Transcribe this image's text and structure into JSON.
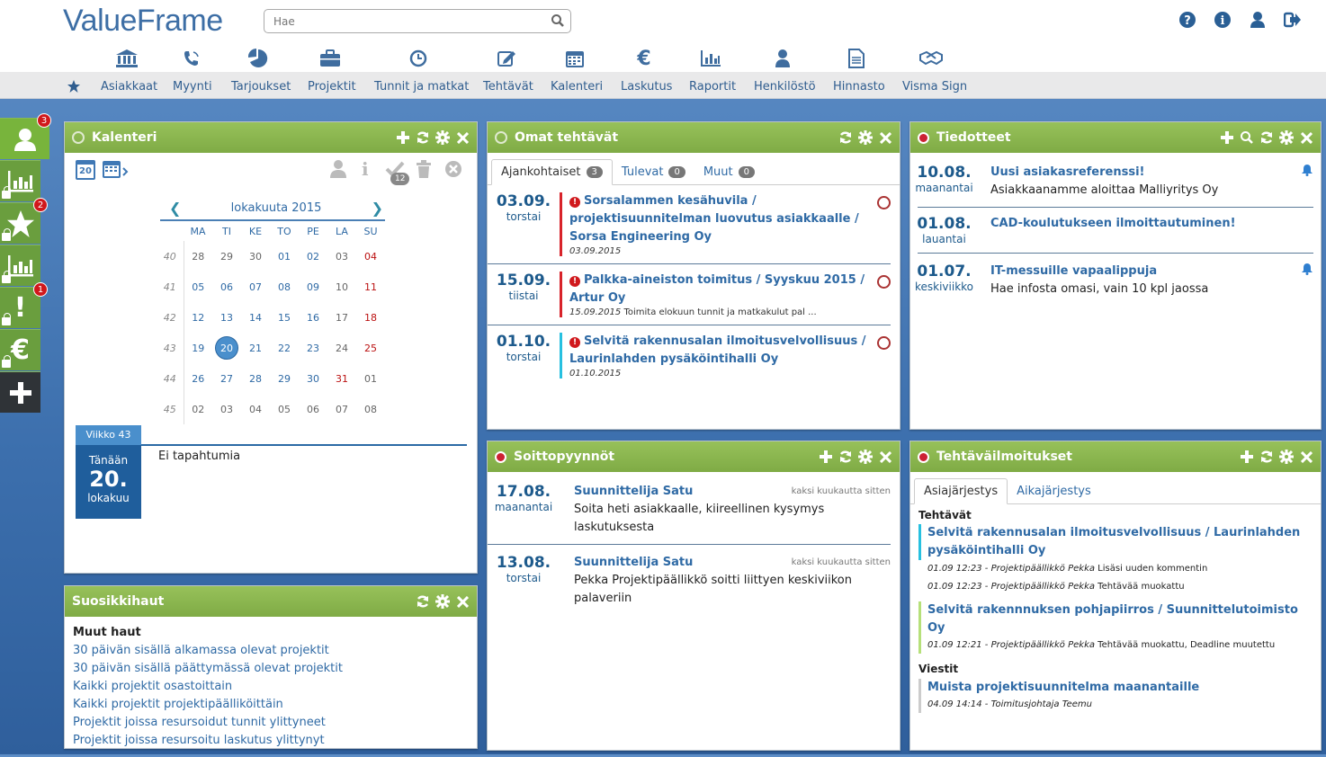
{
  "app": {
    "logo": "ValueFrame",
    "search_placeholder": "Hae"
  },
  "nav": [
    {
      "label": "Asiakkaat",
      "icon": "bank-icon"
    },
    {
      "label": "Myynti",
      "icon": "phone-icon"
    },
    {
      "label": "Tarjoukset",
      "icon": "pie-icon"
    },
    {
      "label": "Projektit",
      "icon": "briefcase-icon"
    },
    {
      "label": "Tunnit ja matkat",
      "icon": "clock-icon"
    },
    {
      "label": "Tehtävät",
      "icon": "edit-icon"
    },
    {
      "label": "Kalenteri",
      "icon": "calendar-icon"
    },
    {
      "label": "Laskutus",
      "icon": "euro-icon"
    },
    {
      "label": "Raportit",
      "icon": "bar-chart-icon"
    },
    {
      "label": "Henkilöstö",
      "icon": "user-icon"
    },
    {
      "label": "Hinnasto",
      "icon": "document-icon"
    },
    {
      "label": "Visma Sign",
      "icon": "handshake-icon"
    }
  ],
  "sidebar": {
    "badges": {
      "users": "3",
      "favorites": "2",
      "alerts": "1"
    }
  },
  "kalenteri": {
    "title": "Kalenteri",
    "toolbar_day": "20",
    "badge": "12",
    "month": "lokakuuta 2015",
    "weekdays": [
      "MA",
      "TI",
      "KE",
      "TO",
      "PE",
      "LA",
      "SU"
    ],
    "weeks": [
      {
        "wk": "40",
        "days": [
          "28",
          "29",
          "30",
          "01",
          "02",
          "03",
          "04"
        ]
      },
      {
        "wk": "41",
        "days": [
          "05",
          "06",
          "07",
          "08",
          "09",
          "10",
          "11"
        ]
      },
      {
        "wk": "42",
        "days": [
          "12",
          "13",
          "14",
          "15",
          "16",
          "17",
          "18"
        ]
      },
      {
        "wk": "43",
        "days": [
          "19",
          "20",
          "21",
          "22",
          "23",
          "24",
          "25"
        ]
      },
      {
        "wk": "44",
        "days": [
          "26",
          "27",
          "28",
          "29",
          "30",
          "31",
          "01"
        ]
      },
      {
        "wk": "45",
        "days": [
          "02",
          "03",
          "04",
          "05",
          "06",
          "07",
          "08"
        ]
      }
    ],
    "week_label": "Viikko 43",
    "today_label": "Tänään",
    "today_day": "20.",
    "today_month": "lokakuu",
    "no_events": "Ei tapahtumia"
  },
  "tasks": {
    "title": "Omat tehtävät",
    "tabs": [
      {
        "label": "Ajankohtaiset",
        "count": "3"
      },
      {
        "label": "Tulevat",
        "count": "0"
      },
      {
        "label": "Muut",
        "count": "0"
      }
    ],
    "items": [
      {
        "date": "03.09.",
        "weekday": "torstai",
        "title": "Sorsalammen kesähuvila / projektisuunnitelman luovutus asiakkaalle / Sorsa Engineering Oy",
        "meta": "03.09.2015",
        "note": ""
      },
      {
        "date": "15.09.",
        "weekday": "tiistai",
        "title": "Palkka-aineiston toimitus / Syyskuu 2015 / Artur Oy",
        "meta": "15.09.2015",
        "note": "Toimita elokuun tunnit ja matkakulut pal ..."
      },
      {
        "date": "01.10.",
        "weekday": "torstai",
        "title": "Selvitä rakennusalan ilmoitusvelvollisuus / Laurinlahden pysäköintihalli Oy",
        "meta": "01.10.2015",
        "note": ""
      }
    ]
  },
  "tiedotteet": {
    "title": "Tiedotteet",
    "items": [
      {
        "date": "10.08.",
        "weekday": "maanantai",
        "title": "Uusi asiakasreferenssi!",
        "body": "Asiakkaanamme aloittaa Malliyritys Oy"
      },
      {
        "date": "01.08.",
        "weekday": "lauantai",
        "title": "CAD-koulutukseen ilmoittautuminen!",
        "body": ""
      },
      {
        "date": "01.07.",
        "weekday": "keskiviikko",
        "title": "IT-messuille vapaalippuja",
        "body": "Hae infosta omasi, vain 10 kpl jaossa"
      }
    ]
  },
  "soitto": {
    "title": "Soittopyynnöt",
    "items": [
      {
        "date": "17.08.",
        "weekday": "maanantai",
        "who": "Suunnittelija Satu",
        "when": "kaksi kuukautta sitten",
        "text": "Soita heti asiakkaalle, kiireellinen kysymys laskutuksesta"
      },
      {
        "date": "13.08.",
        "weekday": "torstai",
        "who": "Suunnittelija Satu",
        "when": "kaksi kuukautta sitten",
        "text": "Pekka Projektipäällikkö soitti liittyen keskiviikon palaveriin"
      }
    ]
  },
  "ilmoitukset": {
    "title": "Tehtäväilmoitukset",
    "tabs": [
      "Asiajärjestys",
      "Aikajärjestys"
    ],
    "tasks_heading": "Tehtävät",
    "tasks": [
      {
        "title": "Selvitä rakennusalan ilmoitusvelvollisuus / Laurinlahden pysäköintihalli Oy",
        "lines": [
          {
            "time": "01.09 12:23 - Projektipäällikkö Pekka",
            "text": "Lisäsi uuden kommentin"
          },
          {
            "time": "01.09 12:23 - Projektipäällikkö Pekka",
            "text": "Tehtävää muokattu"
          }
        ]
      },
      {
        "title": "Selvitä rakennnuksen pohjapiirros / Suunnittelutoimisto Oy",
        "lines": [
          {
            "time": "01.09 12:21 - Projektipäällikkö Pekka",
            "text": "Tehtävää muokattu, Deadline muutettu"
          }
        ]
      }
    ],
    "messages_heading": "Viestit",
    "message": {
      "title": "Muista projektisuunnitelma maanantaille",
      "time": "04.09 14:14 - Toimitusjohtaja Teemu"
    }
  },
  "suosikit": {
    "title": "Suosikkihaut",
    "heading": "Muut haut",
    "links": [
      "30 päivän sisällä alkamassa olevat projektit",
      "30 päivän sisällä päättymässä olevat projektit",
      "Kaikki projektit osastoittain",
      "Kaikki projektit projektipäälliköittäin",
      "Projektit joissa resursoidut tunnit ylittyneet",
      "Projektit joissa resursoitu laskutus ylittynyt"
    ]
  }
}
